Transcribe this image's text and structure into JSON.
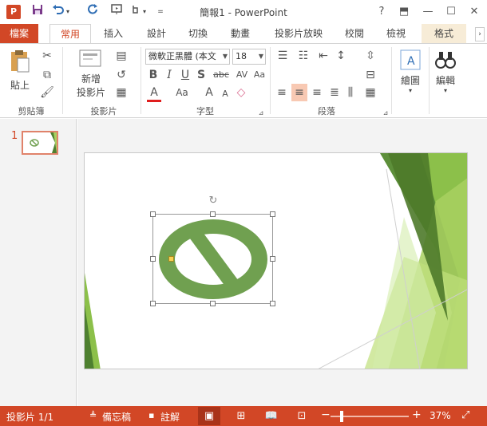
{
  "window": {
    "title": "簡報1 - PowerPoint",
    "app_icon": "P",
    "help": "?",
    "restore_ribbon": "⬒",
    "minimize": "—",
    "maximize": "☐",
    "close": "✕"
  },
  "qat": {
    "save_icon": "save-icon",
    "undo_icon": "undo-icon",
    "redo_icon": "redo-icon",
    "customize_icon": "chevron-down-icon"
  },
  "tabs": {
    "file": "檔案",
    "home": "常用",
    "insert": "插入",
    "design": "設計",
    "transitions": "切換",
    "animations": "動畫",
    "slideshow": "投影片放映",
    "review": "校閱",
    "view": "檢視",
    "format": "格式"
  },
  "ribbon": {
    "clipboard": {
      "paste": "貼上",
      "label": "剪貼簿"
    },
    "slides": {
      "new_slide_line1": "新增",
      "new_slide_line2": "投影片",
      "label": "投影片"
    },
    "font": {
      "font_name": "微軟正黑體 (本文",
      "font_size": "18",
      "label": "字型"
    },
    "paragraph": {
      "label": "段落"
    },
    "drawing": {
      "label": "繪圖"
    },
    "editing": {
      "label": "編輯"
    }
  },
  "thumbnails": [
    {
      "number": "1"
    }
  ],
  "statusbar": {
    "slide_info": "投影片 1/1",
    "notes": "備忘稿",
    "comments": "註解",
    "zoom_minus": "−",
    "zoom_plus": "+",
    "zoom_level": "37%"
  },
  "colors": {
    "accent": "#d24726",
    "shape_fill": "#70a050",
    "slide_green_light": "#a8d060",
    "slide_green_dark": "#4e8030"
  }
}
